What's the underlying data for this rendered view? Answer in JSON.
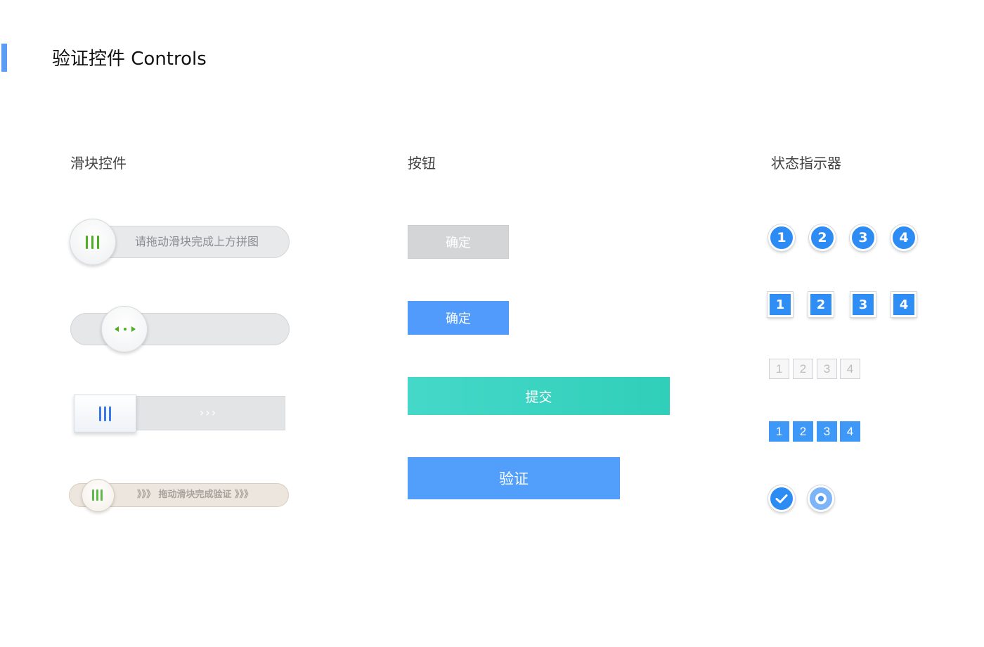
{
  "page": {
    "title": "验证控件 Controls",
    "accent_color": "#5b9cf5"
  },
  "sections": {
    "sliders": "滑块控件",
    "buttons": "按钮",
    "indicators": "状态指示器"
  },
  "sliders": {
    "slider1": {
      "text": "请拖动滑块完成上方拼图",
      "grip_color": "#4caf24"
    },
    "slider2": {
      "icon": "left-right-arrows-icon",
      "icon_color": "#4caf24"
    },
    "slider3": {
      "chevrons": "›››",
      "grip_color": "#3b7be8"
    },
    "slider4": {
      "text": "》》》 拖动滑块完成验证 》》》",
      "grip_color": "#5fba4a"
    }
  },
  "buttons": {
    "confirm_disabled": "确定",
    "confirm_primary": "确定",
    "submit": "提交",
    "verify": "验证"
  },
  "indicators": {
    "circle_steps": [
      "1",
      "2",
      "3",
      "4"
    ],
    "square_steps": [
      "1",
      "2",
      "3",
      "4"
    ],
    "outline_boxes": [
      "1",
      "2",
      "3",
      "4"
    ],
    "filled_boxes": [
      "1",
      "2",
      "3",
      "4"
    ],
    "status_icons": [
      "check-icon",
      "radio-selected-icon"
    ],
    "primary_color": "#2d8cf4"
  }
}
